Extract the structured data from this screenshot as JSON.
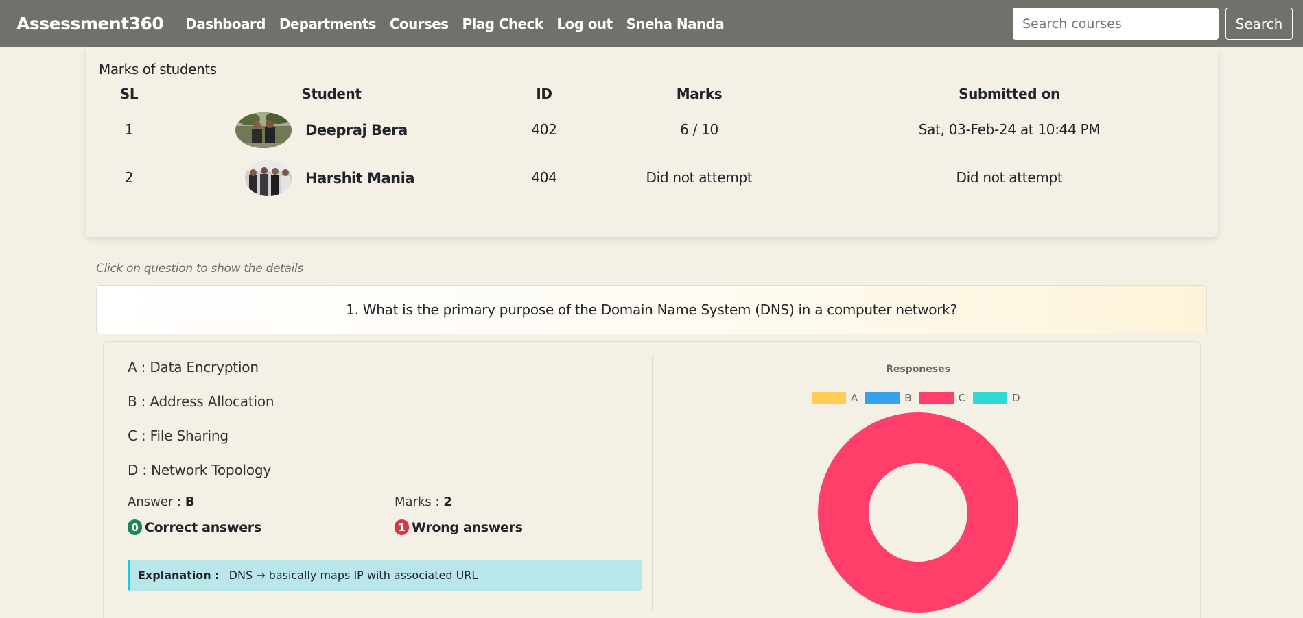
{
  "navbar": {
    "brand": "Assessment360",
    "links": [
      "Dashboard",
      "Departments",
      "Courses",
      "Plag Check",
      "Log out",
      "Sneha Nanda"
    ],
    "search_placeholder": "Search courses",
    "search_button": "Search"
  },
  "marks": {
    "title": "Marks of students",
    "headers": [
      "SL",
      "Student",
      "ID",
      "Marks",
      "Submitted on"
    ],
    "rows": [
      {
        "sl": "1",
        "name": "Deepraj Bera",
        "id": "402",
        "marks": "6 / 10",
        "submitted": "Sat, 03-Feb-24 at 10:44 PM"
      },
      {
        "sl": "2",
        "name": "Harshit Mania",
        "id": "404",
        "marks": "Did not attempt",
        "submitted": "Did not attempt"
      }
    ]
  },
  "hint": "Click on question to show the details",
  "question": {
    "text": "1. What is the primary purpose of the Domain Name System (DNS) in a computer network?",
    "options": [
      "A : Data Encryption",
      "B : Address Allocation",
      "C : File Sharing",
      "D : Network Topology"
    ],
    "answer_label": "Answer : ",
    "answer_value": "B",
    "marks_label": "Marks : ",
    "marks_value": "2",
    "correct_count": "0",
    "correct_label": "Correct answers",
    "wrong_count": "1",
    "wrong_label": "Wrong answers",
    "explanation_label": "Explanation :",
    "explanation_text": "DNS → basically maps IP with associated URL"
  },
  "chart_data": {
    "type": "pie",
    "title": "Responeses",
    "categories": [
      "A",
      "B",
      "C",
      "D"
    ],
    "values": [
      0,
      0,
      1,
      0
    ],
    "colors": [
      "#ffcd56",
      "#36a2eb",
      "#ff3f6a",
      "#2fd9d6"
    ],
    "legend_position": "top"
  }
}
